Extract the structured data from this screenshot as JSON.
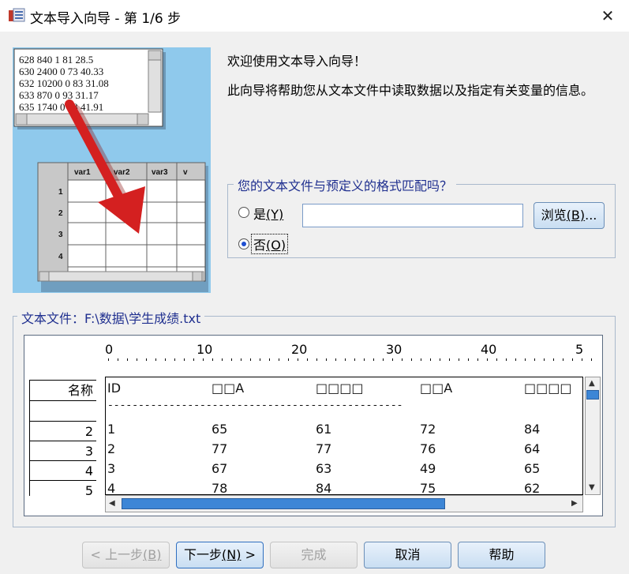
{
  "window": {
    "title": "文本导入向导 - 第 1/6 步",
    "close_glyph": "✕"
  },
  "illustration": {
    "sample_lines": [
      "628 840 1 81 28.5",
      "630 2400 0 73 40.33",
      "632 10200 0 83 31.08",
      "633 870 0 93 31.17",
      "635 1740 0 83 41.91"
    ],
    "grid_columns": [
      "var1",
      "var2",
      "var3",
      "v"
    ],
    "grid_rows": [
      "1",
      "2",
      "3",
      "4"
    ],
    "arrow_color": "#d42020"
  },
  "welcome": {
    "title": "欢迎使用文本导入向导！",
    "description": "此向导将帮助您从文本文件中读取数据以及指定有关变量的信息。"
  },
  "predefined": {
    "legend": "您的文本文件与预定义的格式匹配吗？",
    "yes_label": "是",
    "yes_key": "(Y)",
    "no_label": "否",
    "no_key": "(O)",
    "selected": "no",
    "file_value": "",
    "browse_label": "浏览",
    "browse_key": "(B)",
    "browse_suffix": "..."
  },
  "file_preview": {
    "legend_prefix": "文本文件：",
    "path": "F:\\数据\\学生成绩.txt",
    "ruler": [
      "0",
      "10",
      "20",
      "30",
      "40",
      "5"
    ],
    "row_header_title": "名称",
    "row_numbers": [
      "2",
      "3",
      "4",
      "5"
    ],
    "header_cells": [
      "ID",
      "□□A",
      "□□□□",
      "□□A",
      "□□□□"
    ],
    "separator": "------------------------------------------------",
    "rows": [
      [
        "1",
        "65",
        "61",
        "72",
        "84"
      ],
      [
        "2",
        "77",
        "77",
        "76",
        "64"
      ],
      [
        "3",
        "67",
        "63",
        "49",
        "65"
      ],
      [
        "4",
        "78",
        "84",
        "75",
        "62"
      ]
    ]
  },
  "footer": {
    "back_label": "< 上一步",
    "back_key": "(B)",
    "next_label": "下一步",
    "next_key": "(N)",
    "next_suffix": " >",
    "finish_label": "完成",
    "cancel_label": "取消",
    "help_label": "帮助"
  },
  "colors": {
    "accent_blue": "#1f2f8f",
    "button_gradient_top": "#e8f1fb",
    "button_gradient_bottom": "#c9def2",
    "scroll_thumb": "#3d86d6",
    "illustration_bg": "#8fc9ec"
  }
}
